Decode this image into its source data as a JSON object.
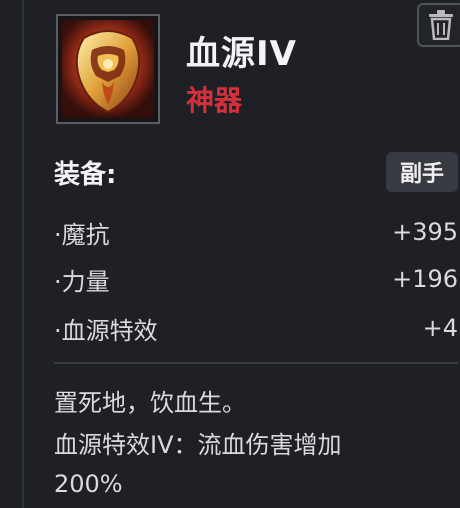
{
  "item": {
    "name": "血源IV",
    "rarity": "神器",
    "rarity_color": "#d4303b",
    "icon": "crimson-mask-icon"
  },
  "actions": {
    "delete_icon": "trash-icon"
  },
  "equip": {
    "label": "装备:",
    "slot": "副手"
  },
  "stats": [
    {
      "name": "·魔抗",
      "value": "+395"
    },
    {
      "name": "·力量",
      "value": "+196"
    },
    {
      "name": "·血源特效",
      "value": "+4"
    }
  ],
  "description": {
    "line1": "置死地，饮血生。",
    "line2": "血源特效IV：流血伤害增加",
    "line3": "200%"
  }
}
